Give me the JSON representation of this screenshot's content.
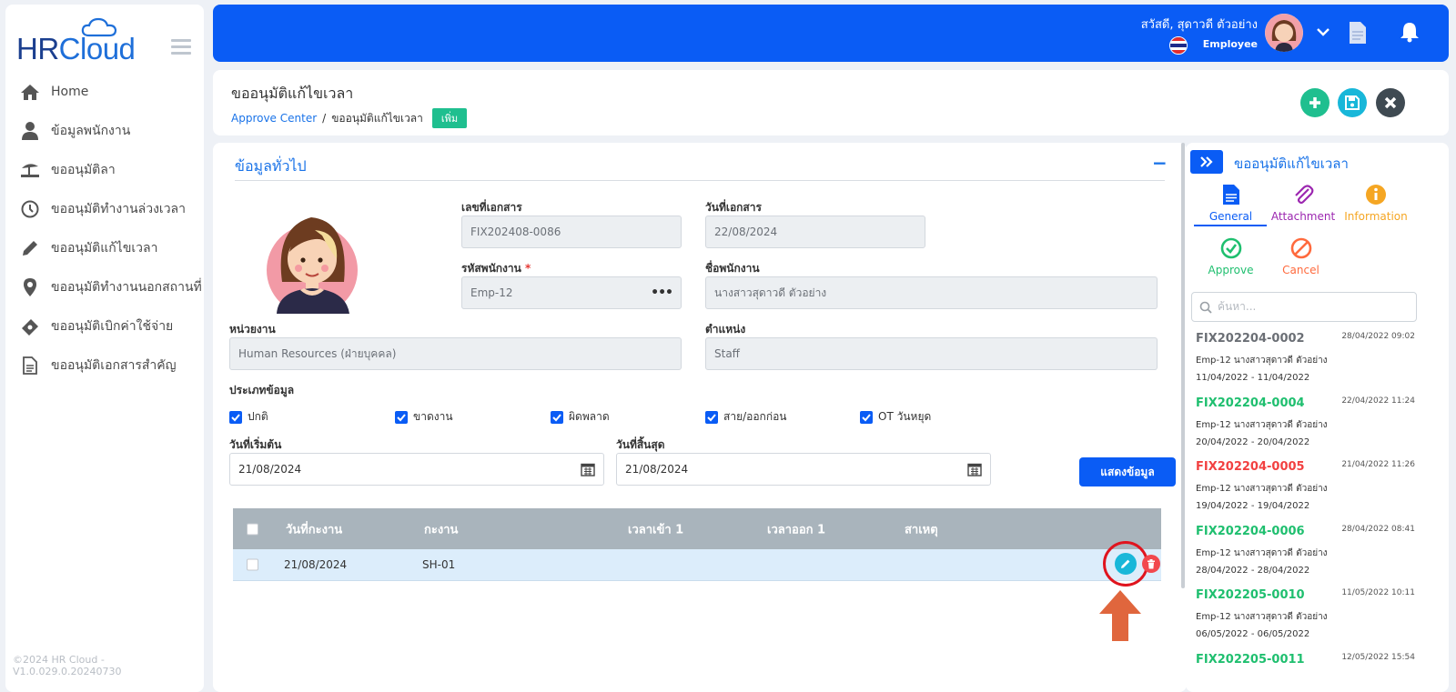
{
  "app": {
    "logo_hr": "HR",
    "logo_cloud": "Cloud",
    "copyright": "©2024 HR Cloud -V1.0.029.0.20240730"
  },
  "sidebar": {
    "items": [
      {
        "label": "Home",
        "icon": "home-icon"
      },
      {
        "label": "ข้อมูลพนักงาน",
        "icon": "user-icon"
      },
      {
        "label": "ขออนุมัติลา",
        "icon": "beach-icon"
      },
      {
        "label": "ขออนุมัติทำงานล่วงเวลา",
        "icon": "clock-icon"
      },
      {
        "label": "ขออนุมัติแก้ไขเวลา",
        "icon": "pencil-icon"
      },
      {
        "label": "ขออนุมัติทำงานนอกสถานที่",
        "icon": "location-pin-icon"
      },
      {
        "label": "ขออนุมัติเบิกค่าใช้จ่าย",
        "icon": "money-icon"
      },
      {
        "label": "ขออนุมัติเอกสารสำคัญ",
        "icon": "document-icon"
      }
    ]
  },
  "topbar": {
    "greeting": "สวัสดี, สุดาวดี ตัวอย่าง",
    "role": "Employee"
  },
  "header": {
    "title": "ขออนุมัติแก้ไขเวลา",
    "breadcrumb_link": "Approve Center",
    "breadcrumb_sep": "/",
    "breadcrumb_current": "ขออนุมัติแก้ไขเวลา",
    "badge": "เพิ่ม"
  },
  "form": {
    "section_title": "ข้อมูลทั่วไป",
    "collapse_label": "−",
    "doc_no_label": "เลขที่เอกสาร",
    "doc_no": "FIX202408-0086",
    "doc_date_label": "วันที่เอกสาร",
    "doc_date": "22/08/2024",
    "emp_code_label": "รหัสพนักงาน",
    "required_mark": "*",
    "emp_code": "Emp-12",
    "emp_name_label": "ชื่อพนักงาน",
    "emp_name": "นางสาวสุดาวดี  ตัวอย่าง",
    "dept_label": "หน่วยงาน",
    "dept": "Human Resources (ฝ่ายบุคคล)",
    "position_label": "ตำแหน่ง",
    "position": "Staff",
    "type_label": "ประเภทข้อมูล",
    "types": [
      "ปกติ",
      "ขาดงาน",
      "ผิดพลาด",
      "สาย/ออกก่อน",
      "OT วันหยุด"
    ],
    "start_label": "วันที่เริ่มต้น",
    "start_date": "21/08/2024",
    "end_label": "วันที่สิ้นสุด",
    "end_date": "21/08/2024",
    "show_button": "แสดงข้อมูล"
  },
  "table": {
    "headers": [
      "วันที่กะงาน",
      "กะงาน",
      "เวลาเข้า 1",
      "เวลาออก 1",
      "สาเหตุ"
    ],
    "rows": [
      {
        "date": "21/08/2024",
        "shift": "SH-01",
        "in1": "",
        "out1": "",
        "reason": ""
      }
    ]
  },
  "right_panel": {
    "title": "ขออนุมัติแก้ไขเวลา",
    "tabs": [
      {
        "label": "General",
        "color": "#0a5cf5"
      },
      {
        "label": "Attachment",
        "color": "#9c27b0"
      },
      {
        "label": "Information",
        "color": "#f5a623"
      },
      {
        "label": "Approve",
        "color": "#1fbf6f"
      },
      {
        "label": "Cancel",
        "color": "#ff6a3d"
      }
    ],
    "search_placeholder": "ค้นหา...",
    "list": [
      {
        "no": "FIX202204-0002",
        "datetime": "28/04/2022 09:02",
        "emp": "Emp-12 นางสาวสุดาวดี ตัวอย่าง",
        "range": "11/04/2022 - 11/04/2022",
        "color": "#6b6f75"
      },
      {
        "no": "FIX202204-0004",
        "datetime": "22/04/2022 11:24",
        "emp": "Emp-12 นางสาวสุดาวดี ตัวอย่าง",
        "range": "20/04/2022 - 20/04/2022",
        "color": "#1fbf6f"
      },
      {
        "no": "FIX202204-0005",
        "datetime": "21/04/2022 11:26",
        "emp": "Emp-12 นางสาวสุดาวดี ตัวอย่าง",
        "range": "19/04/2022 - 19/04/2022",
        "color": "#f24141"
      },
      {
        "no": "FIX202204-0006",
        "datetime": "28/04/2022 08:41",
        "emp": "Emp-12 นางสาวสุดาวดี ตัวอย่าง",
        "range": "28/04/2022 - 28/04/2022",
        "color": "#1fbf6f"
      },
      {
        "no": "FIX202205-0010",
        "datetime": "11/05/2022 10:11",
        "emp": "Emp-12 นางสาวสุดาวดี ตัวอย่าง",
        "range": "06/05/2022 - 06/05/2022",
        "color": "#1fbf6f"
      },
      {
        "no": "FIX202205-0011",
        "datetime": "12/05/2022 15:54",
        "emp": "",
        "range": "",
        "color": "#1fbf6f"
      }
    ]
  },
  "colors": {
    "primary": "#0a5cf5",
    "add_green": "#1fbf8f",
    "save_cyan": "#18b7d9",
    "close_dark": "#3f4a52",
    "highlight_red": "#e0141e",
    "arrow_orange": "#e0663d"
  }
}
